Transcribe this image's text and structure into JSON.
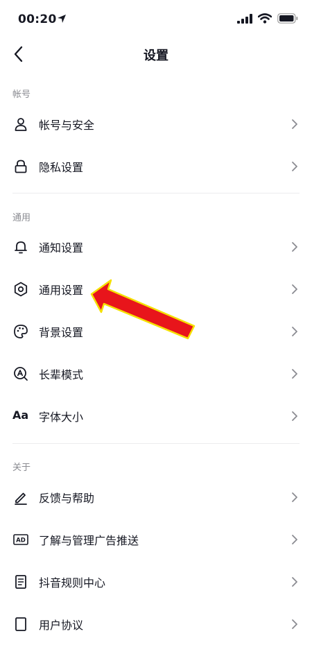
{
  "status_bar": {
    "time": "00:20"
  },
  "nav": {
    "title": "设置"
  },
  "sections": {
    "account": {
      "header": "帐号"
    },
    "general": {
      "header": "通用"
    },
    "about": {
      "header": "关于"
    }
  },
  "items": {
    "account_security": "帐号与安全",
    "privacy": "隐私设置",
    "notification": "通知设置",
    "general_settings": "通用设置",
    "background": "背景设置",
    "elder_mode": "长辈模式",
    "font_size": "字体大小",
    "feedback": "反馈与帮助",
    "ads": "了解与管理广告推送",
    "rules_center": "抖音规则中心",
    "user_agreement": "用户协议"
  },
  "icons": {
    "font_size_glyph": "Aa",
    "ad_glyph": "AD"
  },
  "colors": {
    "arrow_fill": "#e8151b",
    "arrow_outline": "#f5e000",
    "text_primary": "#161823",
    "text_secondary": "#8a8b91"
  }
}
